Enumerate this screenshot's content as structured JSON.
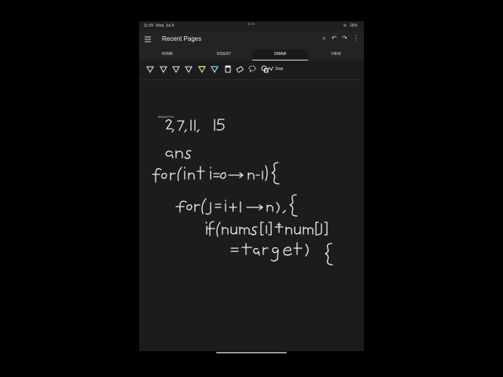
{
  "status_bar": {
    "time": "11:09",
    "date": "Wed, Jul 8",
    "battery": "26"
  },
  "app_bar": {
    "title": "Recent Pages"
  },
  "tabs": [
    {
      "label": "HOME",
      "active": false
    },
    {
      "label": "INSERT",
      "active": false
    },
    {
      "label": "DRAW",
      "active": true
    },
    {
      "label": "VIEW",
      "active": false
    }
  ],
  "toolbar": {
    "tools": [
      "pen-icon",
      "pen-icon",
      "pen-icon",
      "pen-icon",
      "highlighter-icon",
      "highlighter-icon",
      "highlighter-icon",
      "eraser-icon",
      "lasso-icon",
      "shapes-icon"
    ],
    "stop_label": "Stop",
    "tool_tip": "Ballpoint Pen",
    "highlighter_colors": [
      "#e6d21e",
      "#27c5ff",
      "#f2f2f2"
    ]
  },
  "note": {
    "lines": [
      "2,7,11,15",
      "ans",
      "for(int i=0 → n-1){",
      "for(j=i+1 → n){",
      "if(nums[i]+num[j]",
      "= target){"
    ]
  }
}
